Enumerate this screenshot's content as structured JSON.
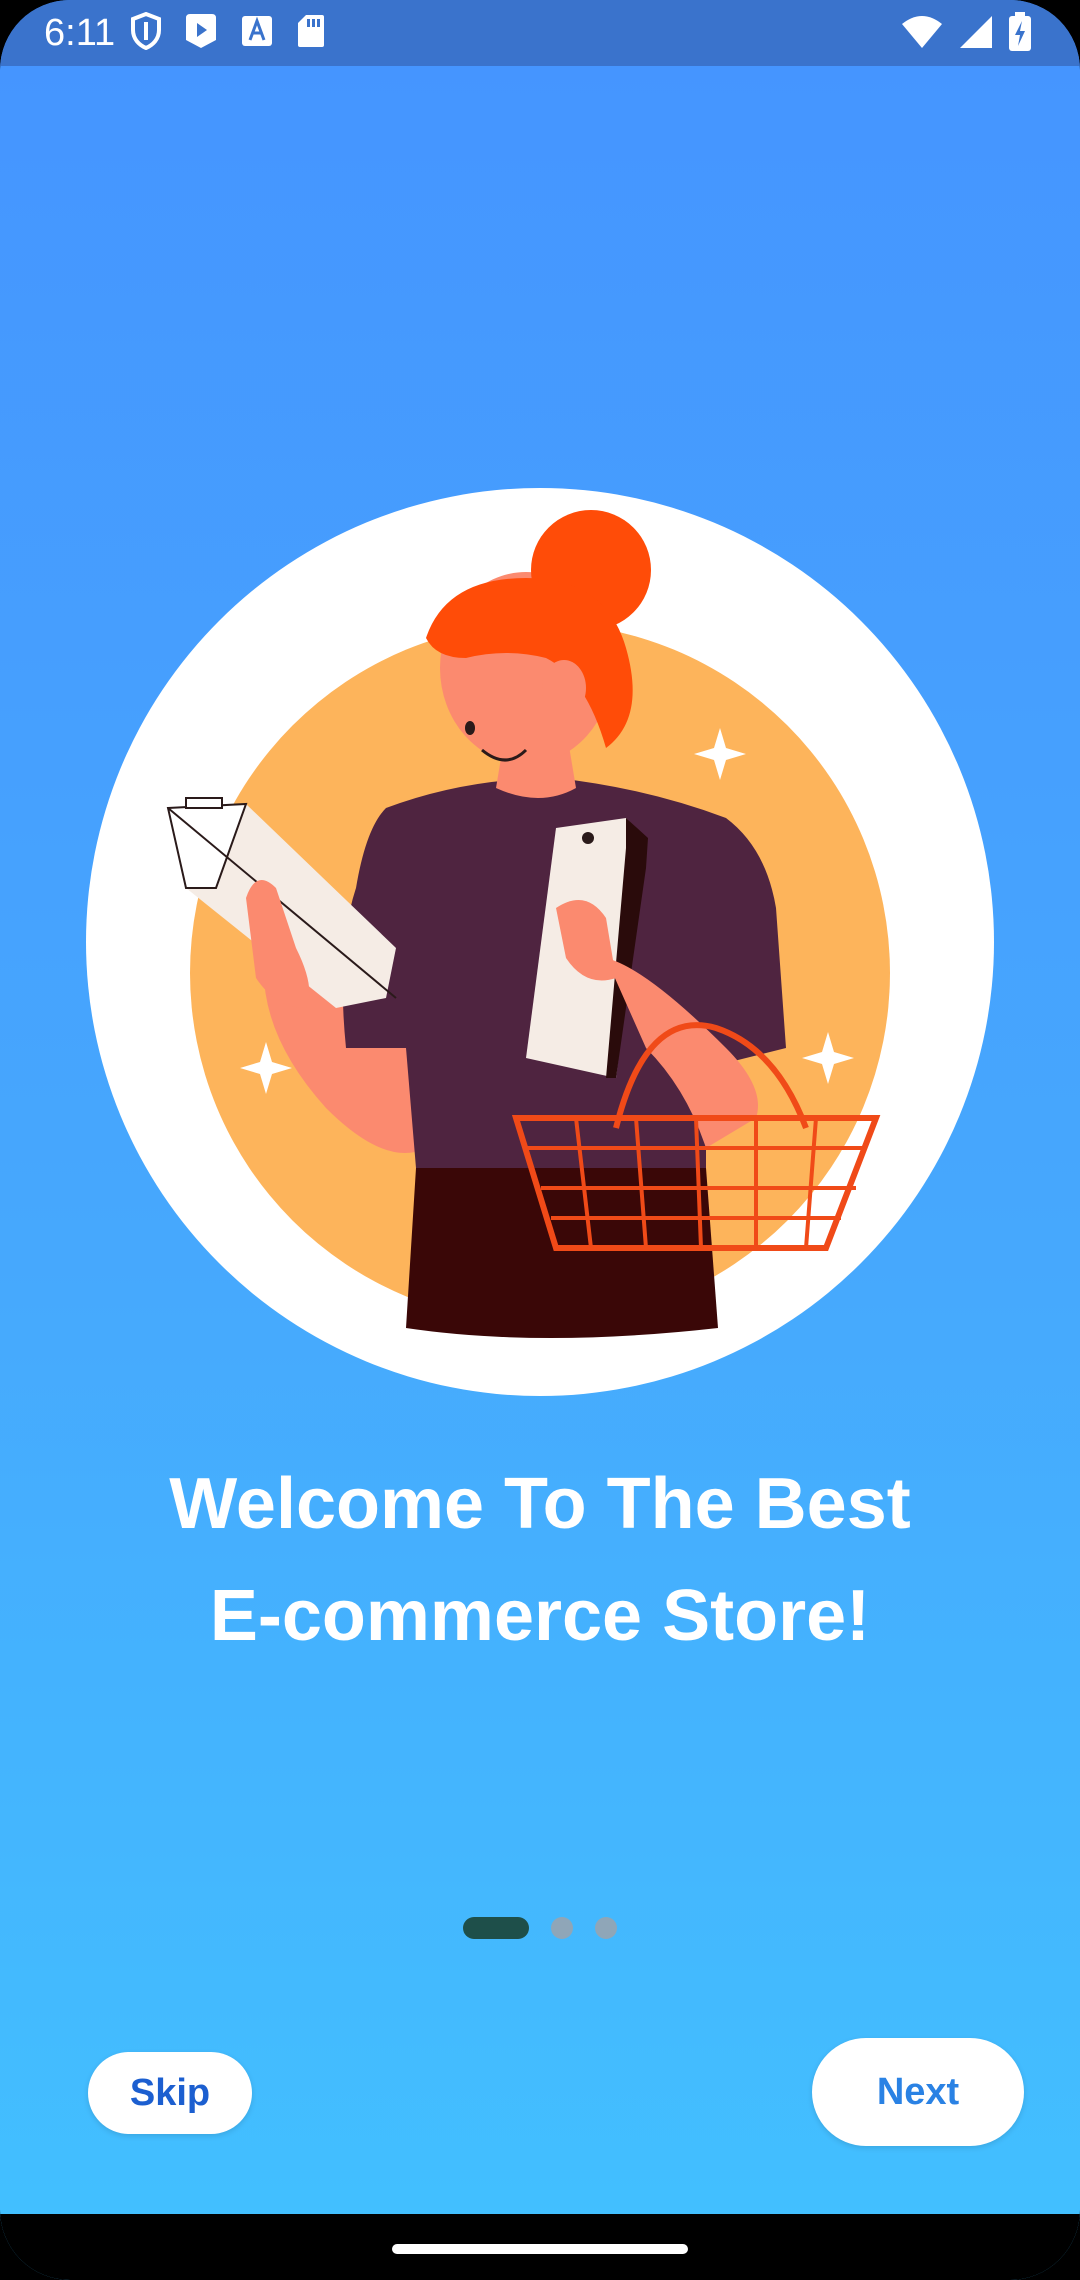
{
  "status_bar": {
    "time": "6:11",
    "left_icons": [
      "shield-icon",
      "play-store-icon",
      "font-a-icon",
      "sd-card-icon"
    ],
    "right_icons": [
      "wifi-icon",
      "signal-icon",
      "battery-charging-icon"
    ]
  },
  "onboarding": {
    "illustration": "woman-with-shopping-basket-illustration",
    "title_line1": "Welcome To The Best",
    "title_line2": "E-commerce Store!",
    "page_count": 3,
    "active_page": 1
  },
  "buttons": {
    "skip_label": "Skip",
    "next_label": "Next"
  },
  "colors": {
    "background_top": "#4594ff",
    "background_bottom": "#42c1ff",
    "status_bar": "#3a73cc",
    "active_dot": "#1e4f4a",
    "inactive_dot": "#8fa6b8",
    "button_text": "#1c5fd0"
  }
}
